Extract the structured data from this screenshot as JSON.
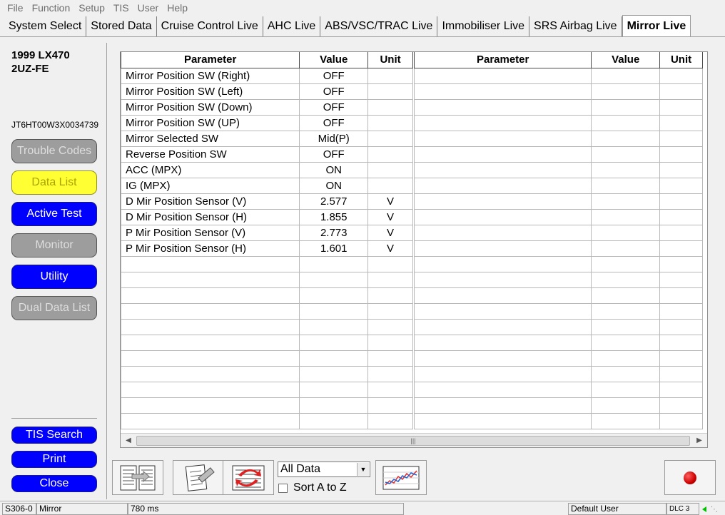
{
  "menu": [
    "File",
    "Function",
    "Setup",
    "TIS",
    "User",
    "Help"
  ],
  "tabs": [
    {
      "label": "System Select",
      "active": false
    },
    {
      "label": "Stored Data",
      "active": false
    },
    {
      "label": "Cruise Control Live",
      "active": false
    },
    {
      "label": "AHC Live",
      "active": false
    },
    {
      "label": "ABS/VSC/TRAC Live",
      "active": false
    },
    {
      "label": "Immobiliser Live",
      "active": false
    },
    {
      "label": "SRS Airbag Live",
      "active": false
    },
    {
      "label": "Mirror Live",
      "active": true
    }
  ],
  "vehicle": {
    "model": "1999 LX470",
    "engine": "2UZ-FE",
    "vin": "JT6HT00W3X0034739"
  },
  "side_buttons": {
    "trouble_codes": "Trouble Codes",
    "data_list": "Data List",
    "active_test": "Active Test",
    "monitor": "Monitor",
    "utility": "Utility",
    "dual_data_list": "Dual Data List",
    "tis_search": "TIS Search",
    "print": "Print",
    "close": "Close"
  },
  "table_headers": {
    "parameter": "Parameter",
    "value": "Value",
    "unit": "Unit"
  },
  "rows": [
    {
      "parameter": "Mirror Position SW (Right)",
      "value": "OFF",
      "unit": ""
    },
    {
      "parameter": "Mirror Position SW (Left)",
      "value": "OFF",
      "unit": ""
    },
    {
      "parameter": "Mirror Position SW (Down)",
      "value": "OFF",
      "unit": ""
    },
    {
      "parameter": "Mirror Position SW (UP)",
      "value": "OFF",
      "unit": ""
    },
    {
      "parameter": "Mirror Selected SW",
      "value": "Mid(P)",
      "unit": ""
    },
    {
      "parameter": "Reverse Position SW",
      "value": "OFF",
      "unit": ""
    },
    {
      "parameter": "ACC (MPX)",
      "value": "ON",
      "unit": ""
    },
    {
      "parameter": "IG (MPX)",
      "value": "ON",
      "unit": ""
    },
    {
      "parameter": "D Mir Position Sensor (V)",
      "value": "2.577",
      "unit": "V"
    },
    {
      "parameter": "D Mir Position Sensor (H)",
      "value": "1.855",
      "unit": "V"
    },
    {
      "parameter": "P Mir Position Sensor (V)",
      "value": "2.773",
      "unit": "V"
    },
    {
      "parameter": "P Mir Position Sensor (H)",
      "value": "1.601",
      "unit": "V"
    }
  ],
  "toolbar": {
    "filter_selected": "All Data",
    "sort_label": "Sort A to Z",
    "sort_checked": false
  },
  "status": {
    "code": "S306-0",
    "system": "Mirror",
    "interval": "780 ms",
    "user": "Default User",
    "dlc": "DLC 3"
  },
  "colors": {
    "button_blue": "#0000ff",
    "button_yellow": "#ffff33",
    "button_gray": "#9d9d9d",
    "record_red": "#cc0000"
  }
}
